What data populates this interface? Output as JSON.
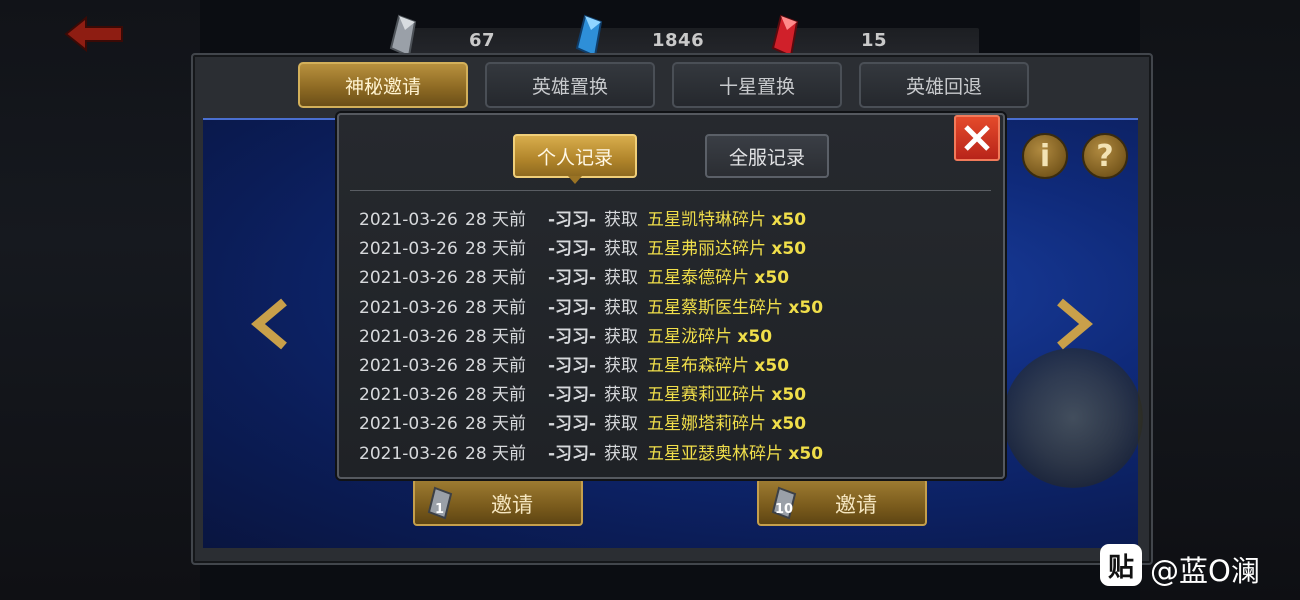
{
  "resources": [
    {
      "icon": "gray-crystal-icon",
      "value": "67"
    },
    {
      "icon": "blue-crystal-icon",
      "value": "1846"
    },
    {
      "icon": "red-crystal-icon",
      "value": "15"
    }
  ],
  "tabs": [
    {
      "label": "神秘邀请",
      "active": true
    },
    {
      "label": "英雄置换",
      "active": false
    },
    {
      "label": "十星置换",
      "active": false
    },
    {
      "label": "英雄回退",
      "active": false
    }
  ],
  "invite_buttons": [
    {
      "label": "邀请",
      "count": "1"
    },
    {
      "label": "邀请",
      "count": "10"
    }
  ],
  "info_buttons": {
    "info": "i",
    "help": "?"
  },
  "popup": {
    "tabs": [
      {
        "label": "个人记录",
        "active": true
      },
      {
        "label": "全服记录",
        "active": false
      }
    ],
    "records": [
      {
        "date": "2021-03-26",
        "ago": "28 天前",
        "name": "-习习-",
        "verb": "获取",
        "item": "五星凯特琳碎片",
        "qty": "x50"
      },
      {
        "date": "2021-03-26",
        "ago": "28 天前",
        "name": "-习习-",
        "verb": "获取",
        "item": "五星弗丽达碎片",
        "qty": "x50"
      },
      {
        "date": "2021-03-26",
        "ago": "28 天前",
        "name": "-习习-",
        "verb": "获取",
        "item": "五星泰德碎片",
        "qty": "x50"
      },
      {
        "date": "2021-03-26",
        "ago": "28 天前",
        "name": "-习习-",
        "verb": "获取",
        "item": "五星蔡斯医生碎片",
        "qty": "x50"
      },
      {
        "date": "2021-03-26",
        "ago": "28 天前",
        "name": "-习习-",
        "verb": "获取",
        "item": "五星泷碎片",
        "qty": "x50"
      },
      {
        "date": "2021-03-26",
        "ago": "28 天前",
        "name": "-习习-",
        "verb": "获取",
        "item": "五星布森碎片",
        "qty": "x50"
      },
      {
        "date": "2021-03-26",
        "ago": "28 天前",
        "name": "-习习-",
        "verb": "获取",
        "item": "五星赛莉亚碎片",
        "qty": "x50"
      },
      {
        "date": "2021-03-26",
        "ago": "28 天前",
        "name": "-习习-",
        "verb": "获取",
        "item": "五星娜塔莉碎片",
        "qty": "x50"
      },
      {
        "date": "2021-03-26",
        "ago": "28 天前",
        "name": "-习习-",
        "verb": "获取",
        "item": "五星亚瑟奥林碎片",
        "qty": "x50"
      }
    ]
  },
  "watermark": {
    "logo": "贴",
    "text": "@蓝O澜"
  },
  "colors": {
    "accent_gold": "#b8913e",
    "item_yellow": "#f0de4a",
    "close_red": "#d9362a",
    "scene_blue": "#0f2a7a"
  }
}
